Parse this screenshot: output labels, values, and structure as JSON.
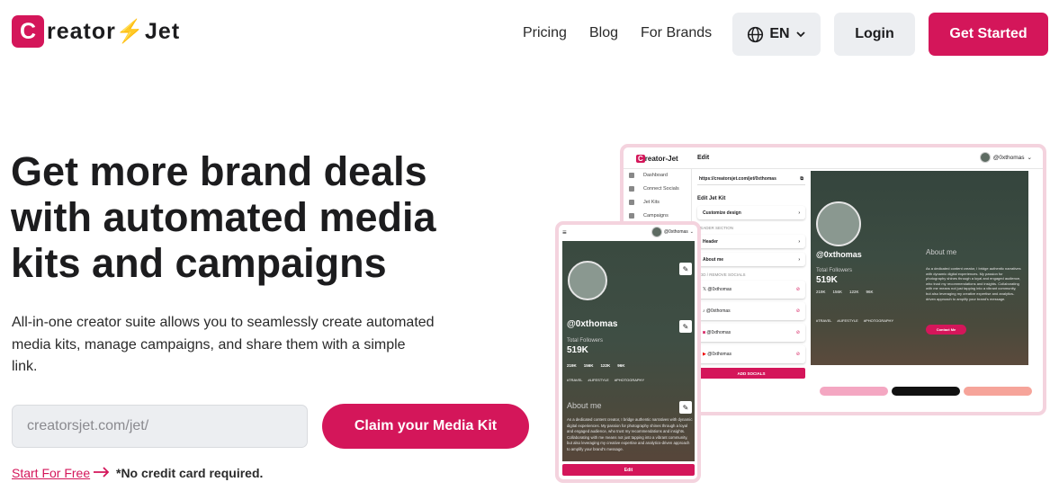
{
  "header": {
    "logo": {
      "mark": "C",
      "word_before": "reator",
      "bolt": "⚡",
      "word_after": "Jet"
    },
    "nav": [
      "Pricing",
      "Blog",
      "For Brands"
    ],
    "language": "EN",
    "login": "Login",
    "get_started": "Get Started"
  },
  "hero": {
    "title": "Get more brand deals with automated media kits and campaigns",
    "subtitle": "All-in-one creator suite allows you to seamlessly create automated media kits, manage campaigns, and share them with a simple link.",
    "input_placeholder": "creatorsjet.com/jet/",
    "claim_button": "Claim your Media Kit",
    "start_free": "Start For Free",
    "no_credit": "*No credit card required."
  },
  "desktop_mockup": {
    "logo": {
      "mark": "C",
      "rest": "reator-Jet"
    },
    "edit_title": "Edit",
    "username": "@0xthomas",
    "sidebar": [
      "Dashboard",
      "Connect Socials",
      "Jet Kits",
      "Campaigns"
    ],
    "url": "https://creatorsjet.com/jet/0xthomas",
    "panel_title": "Edit Jet Kit",
    "customize": "Customize design",
    "header_section": "HEADER SECTION",
    "header_item": "Header",
    "about_item": "About me",
    "socials_section": "ADD / REMOVE SOCIALS",
    "socials": [
      "@0xthomas",
      "@0xthomas",
      "@0xthomas",
      "@0xthomas"
    ],
    "add_socials": "ADD SOCIALS",
    "preview": {
      "handle": "@0xthomas",
      "total_followers": "Total Followers",
      "followers": "519K",
      "stats": [
        "219K",
        "156K",
        "122K",
        "96K"
      ],
      "tags": [
        "#TRAVEL",
        "#LIFESTYLE",
        "#PHOTOGRAPHY"
      ],
      "about_title": "About me",
      "about_text": "As a dedicated content creator, I bridge authentic narratives with dynamic digital experiences. My passion for photography shines through a loyal and engaged audience, who trust my recommendations and insights. Collaborating with me means not just tapping into a vibrant community, but also leveraging my creative expertise and analytics-driven approach to amplify your brand's message.",
      "contact": "Contact Me"
    }
  },
  "mobile_mockup": {
    "username": "@0xthomas",
    "handle": "@0xthomas",
    "total_followers": "Total Followers",
    "followers": "519K",
    "stats": [
      "219K",
      "156K",
      "122K",
      "96K"
    ],
    "tags": [
      "#TRAVEL",
      "#LIFESTYLE",
      "#PHOTOGRAPHY"
    ],
    "about_title": "About me",
    "about_text": "As a dedicated content creator, I bridge authentic narratives with dynamic digital experiences. My passion for photography shines through a loyal and engaged audience, who trust my recommendations and insights. Collaborating with me means not just tapping into a vibrant community, but also leveraging my creative expertise and analytics-driven approach to amplify your brand's message.",
    "edit": "Edit"
  },
  "colors": {
    "brand": "#d4165a",
    "button_gray": "#eceef1",
    "text": "#1c1c1e"
  }
}
